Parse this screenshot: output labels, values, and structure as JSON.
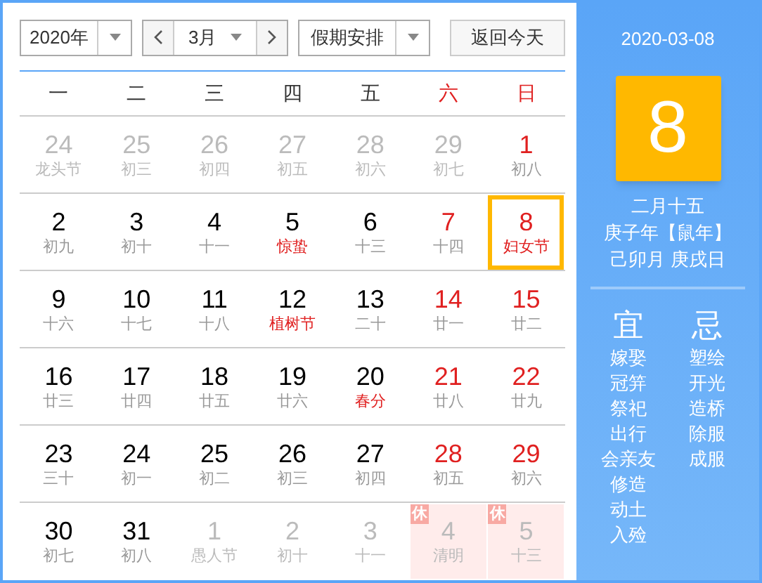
{
  "toolbar": {
    "year": "2020年",
    "month": "3月",
    "holiday_select": "假期安排",
    "today_button": "返回今天"
  },
  "weekdays": [
    {
      "label": "一",
      "weekend": false
    },
    {
      "label": "二",
      "weekend": false
    },
    {
      "label": "三",
      "weekend": false
    },
    {
      "label": "四",
      "weekend": false
    },
    {
      "label": "五",
      "weekend": false
    },
    {
      "label": "六",
      "weekend": true
    },
    {
      "label": "日",
      "weekend": true
    }
  ],
  "days": [
    {
      "day": "24",
      "lunar": "龙头节",
      "kind": "other",
      "festival": false,
      "selected": false
    },
    {
      "day": "25",
      "lunar": "初三",
      "kind": "other",
      "festival": false,
      "selected": false
    },
    {
      "day": "26",
      "lunar": "初四",
      "kind": "other",
      "festival": false,
      "selected": false
    },
    {
      "day": "27",
      "lunar": "初五",
      "kind": "other",
      "festival": false,
      "selected": false
    },
    {
      "day": "28",
      "lunar": "初六",
      "kind": "other",
      "festival": false,
      "selected": false
    },
    {
      "day": "29",
      "lunar": "初七",
      "kind": "other",
      "festival": false,
      "selected": false
    },
    {
      "day": "1",
      "lunar": "初八",
      "kind": "weekend",
      "festival": false,
      "selected": false
    },
    {
      "day": "2",
      "lunar": "初九",
      "kind": "weekday",
      "festival": false,
      "selected": false
    },
    {
      "day": "3",
      "lunar": "初十",
      "kind": "weekday",
      "festival": false,
      "selected": false
    },
    {
      "day": "4",
      "lunar": "十一",
      "kind": "weekday",
      "festival": false,
      "selected": false
    },
    {
      "day": "5",
      "lunar": "惊蛰",
      "kind": "weekday",
      "festival": true,
      "selected": false
    },
    {
      "day": "6",
      "lunar": "十三",
      "kind": "weekday",
      "festival": false,
      "selected": false
    },
    {
      "day": "7",
      "lunar": "十四",
      "kind": "weekend",
      "festival": false,
      "selected": false
    },
    {
      "day": "8",
      "lunar": "妇女节",
      "kind": "weekend",
      "festival": true,
      "selected": true
    },
    {
      "day": "9",
      "lunar": "十六",
      "kind": "weekday",
      "festival": false,
      "selected": false
    },
    {
      "day": "10",
      "lunar": "十七",
      "kind": "weekday",
      "festival": false,
      "selected": false
    },
    {
      "day": "11",
      "lunar": "十八",
      "kind": "weekday",
      "festival": false,
      "selected": false
    },
    {
      "day": "12",
      "lunar": "植树节",
      "kind": "weekday",
      "festival": true,
      "selected": false
    },
    {
      "day": "13",
      "lunar": "二十",
      "kind": "weekday",
      "festival": false,
      "selected": false
    },
    {
      "day": "14",
      "lunar": "廿一",
      "kind": "weekend",
      "festival": false,
      "selected": false
    },
    {
      "day": "15",
      "lunar": "廿二",
      "kind": "weekend",
      "festival": false,
      "selected": false
    },
    {
      "day": "16",
      "lunar": "廿三",
      "kind": "weekday",
      "festival": false,
      "selected": false
    },
    {
      "day": "17",
      "lunar": "廿四",
      "kind": "weekday",
      "festival": false,
      "selected": false
    },
    {
      "day": "18",
      "lunar": "廿五",
      "kind": "weekday",
      "festival": false,
      "selected": false
    },
    {
      "day": "19",
      "lunar": "廿六",
      "kind": "weekday",
      "festival": false,
      "selected": false
    },
    {
      "day": "20",
      "lunar": "春分",
      "kind": "weekday",
      "festival": true,
      "selected": false
    },
    {
      "day": "21",
      "lunar": "廿八",
      "kind": "weekend",
      "festival": false,
      "selected": false
    },
    {
      "day": "22",
      "lunar": "廿九",
      "kind": "weekend",
      "festival": false,
      "selected": false
    },
    {
      "day": "23",
      "lunar": "三十",
      "kind": "weekday",
      "festival": false,
      "selected": false
    },
    {
      "day": "24",
      "lunar": "初一",
      "kind": "weekday",
      "festival": false,
      "selected": false
    },
    {
      "day": "25",
      "lunar": "初二",
      "kind": "weekday",
      "festival": false,
      "selected": false
    },
    {
      "day": "26",
      "lunar": "初三",
      "kind": "weekday",
      "festival": false,
      "selected": false
    },
    {
      "day": "27",
      "lunar": "初四",
      "kind": "weekday",
      "festival": false,
      "selected": false
    },
    {
      "day": "28",
      "lunar": "初五",
      "kind": "weekend",
      "festival": false,
      "selected": false
    },
    {
      "day": "29",
      "lunar": "初六",
      "kind": "weekend",
      "festival": false,
      "selected": false
    },
    {
      "day": "30",
      "lunar": "初七",
      "kind": "weekday",
      "festival": false,
      "selected": false
    },
    {
      "day": "31",
      "lunar": "初八",
      "kind": "weekday",
      "festival": false,
      "selected": false
    },
    {
      "day": "1",
      "lunar": "愚人节",
      "kind": "other",
      "festival": false,
      "selected": false
    },
    {
      "day": "2",
      "lunar": "初十",
      "kind": "other",
      "festival": false,
      "selected": false
    },
    {
      "day": "3",
      "lunar": "十一",
      "kind": "other",
      "festival": false,
      "selected": false
    },
    {
      "day": "4",
      "lunar": "清明",
      "kind": "other",
      "festival": false,
      "selected": false,
      "badge": "休"
    },
    {
      "day": "5",
      "lunar": "十三",
      "kind": "other",
      "festival": false,
      "selected": false,
      "badge": "休"
    }
  ],
  "side": {
    "date": "2020-03-08",
    "big_day": "8",
    "lunar_date": "二月十五",
    "year_line": "庚子年【鼠年】",
    "ganzhi": "己卯月 庚戌日",
    "good": {
      "title": "宜",
      "items": [
        "嫁娶",
        "冠笄",
        "祭祀",
        "出行",
        "会亲友",
        "修造",
        "动土",
        "入殓"
      ]
    },
    "bad": {
      "title": "忌",
      "items": [
        "塑绘",
        "开光",
        "造桥",
        "除服",
        "成服"
      ]
    }
  }
}
